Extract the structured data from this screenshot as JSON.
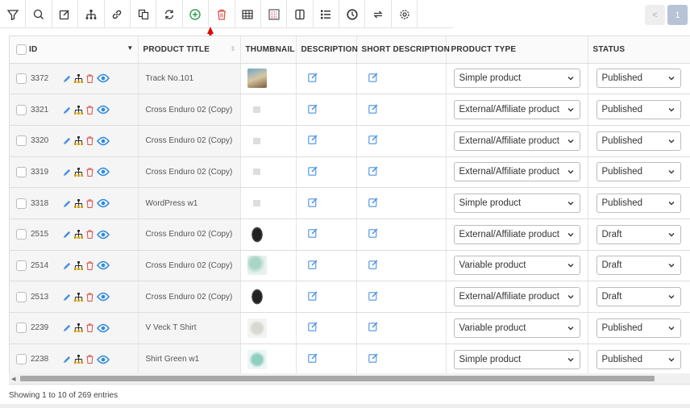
{
  "toolbar": {
    "buttons": [
      "filter-icon",
      "search-icon",
      "edit-icon",
      "hierarchy-icon",
      "link-icon",
      "duplicate-icon",
      "refresh-icon",
      "add-icon",
      "trash-icon",
      "table-icon",
      "grid-icon",
      "columns-icon",
      "list-icon",
      "clock-icon",
      "swap-icon",
      "gear-icon"
    ]
  },
  "pagination": {
    "prev": "<",
    "current": "1"
  },
  "columns": {
    "id": "ID",
    "title": "PRODUCT TITLE",
    "thumbnail": "THUMBNAIL",
    "description": "DESCRIPTION",
    "short_description": "SHORT DESCRIPTION",
    "product_type": "PRODUCT TYPE",
    "status": "STATUS"
  },
  "rows": [
    {
      "id": "3372",
      "title": "Track No.101",
      "thumb": "photo",
      "type": "Simple product",
      "status": "Published"
    },
    {
      "id": "3321",
      "title": "Cross Enduro 02 (Copy)",
      "thumb": "placeholder",
      "type": "External/Affiliate product",
      "status": "Published"
    },
    {
      "id": "3320",
      "title": "Cross Enduro 02 (Copy)",
      "thumb": "placeholder",
      "type": "External/Affiliate product",
      "status": "Published"
    },
    {
      "id": "3319",
      "title": "Cross Enduro 02 (Copy)",
      "thumb": "placeholder",
      "type": "External/Affiliate product",
      "status": "Published"
    },
    {
      "id": "3318",
      "title": "WordPress w1",
      "thumb": "placeholder",
      "type": "Simple product",
      "status": "Published"
    },
    {
      "id": "2515",
      "title": "Cross Enduro 02 (Copy)",
      "thumb": "tire",
      "type": "External/Affiliate product",
      "status": "Draft"
    },
    {
      "id": "2514",
      "title": "Cross Enduro 02 (Copy)",
      "thumb": "shirts",
      "type": "Variable product",
      "status": "Draft"
    },
    {
      "id": "2513",
      "title": "Cross Enduro 02 (Copy)",
      "thumb": "tire",
      "type": "External/Affiliate product",
      "status": "Draft"
    },
    {
      "id": "2239",
      "title": "V Veck T Shirt",
      "thumb": "tshirt",
      "type": "Variable product",
      "status": "Published"
    },
    {
      "id": "2238",
      "title": "Shirt Green w1",
      "thumb": "greenshirt",
      "type": "Simple product",
      "status": "Published"
    }
  ],
  "footer": {
    "info": "Showing 1 to 10 of 269 entries"
  },
  "colors": {
    "accent": "#4a90e2",
    "add": "#2e9e4f",
    "delete": "#d9534f",
    "arrow": "#e00000"
  }
}
